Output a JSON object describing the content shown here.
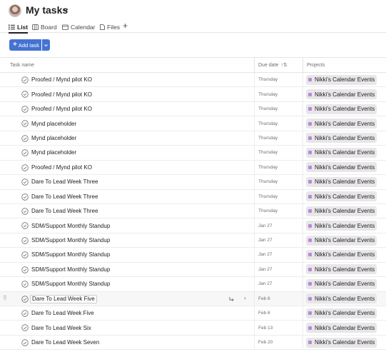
{
  "header": {
    "title": "My tasks"
  },
  "tabs": [
    {
      "label": "List",
      "icon": "list-icon",
      "active": true
    },
    {
      "label": "Board",
      "icon": "board-icon",
      "active": false
    },
    {
      "label": "Calendar",
      "icon": "calendar-icon",
      "active": false
    },
    {
      "label": "Files",
      "icon": "files-icon",
      "active": false
    }
  ],
  "toolbar": {
    "add_task_label": "Add task"
  },
  "columns": {
    "task_name": "Task name",
    "due_date": "Due date",
    "projects": "Projects"
  },
  "colors": {
    "accent": "#4573d2",
    "project_dot": "#b88ad4",
    "project_pill_bg": "#e8e6e8"
  },
  "tasks": [
    {
      "name": "Proofed / Mynd pilot KO",
      "due": "Thursday",
      "project": "Nikki's Calendar Events"
    },
    {
      "name": "Proofed / Mynd pilot KO",
      "due": "Thursday",
      "project": "Nikki's Calendar Events"
    },
    {
      "name": "Proofed / Mynd pilot KO",
      "due": "Thursday",
      "project": "Nikki's Calendar Events"
    },
    {
      "name": "Mynd placeholder",
      "due": "Thursday",
      "project": "Nikki's Calendar Events"
    },
    {
      "name": "Mynd placeholder",
      "due": "Thursday",
      "project": "Nikki's Calendar Events"
    },
    {
      "name": "Mynd placeholder",
      "due": "Thursday",
      "project": "Nikki's Calendar Events"
    },
    {
      "name": "Proofed / Mynd pilot KO",
      "due": "Thursday",
      "project": "Nikki's Calendar Events"
    },
    {
      "name": "Dare To Lead Week Three",
      "due": "Thursday",
      "project": "Nikki's Calendar Events"
    },
    {
      "name": "Dare To Lead Week Three",
      "due": "Thursday",
      "project": "Nikki's Calendar Events"
    },
    {
      "name": "Dare To Lead Week Three",
      "due": "Thursday",
      "project": "Nikki's Calendar Events"
    },
    {
      "name": "SDM/Support Monthly Standup",
      "due": "Jan 27",
      "project": "Nikki's Calendar Events"
    },
    {
      "name": "SDM/Support Monthly Standup",
      "due": "Jan 27",
      "project": "Nikki's Calendar Events"
    },
    {
      "name": "SDM/Support Monthly Standup",
      "due": "Jan 27",
      "project": "Nikki's Calendar Events"
    },
    {
      "name": "SDM/Support Monthly Standup",
      "due": "Jan 27",
      "project": "Nikki's Calendar Events"
    },
    {
      "name": "SDM/Support Monthly Standup",
      "due": "Jan 27",
      "project": "Nikki's Calendar Events"
    },
    {
      "name": "Dare To Lead Week Five",
      "due": "Feb 6",
      "project": "Nikki's Calendar Events",
      "hover": true
    },
    {
      "name": "Dare To Lead Week Five",
      "due": "Feb 6",
      "project": "Nikki's Calendar Events"
    },
    {
      "name": "Dare To Lead Week Six",
      "due": "Feb 13",
      "project": "Nikki's Calendar Events"
    },
    {
      "name": "Dare To Lead Week Seven",
      "due": "Feb 20",
      "project": "Nikki's Calendar Events"
    }
  ]
}
